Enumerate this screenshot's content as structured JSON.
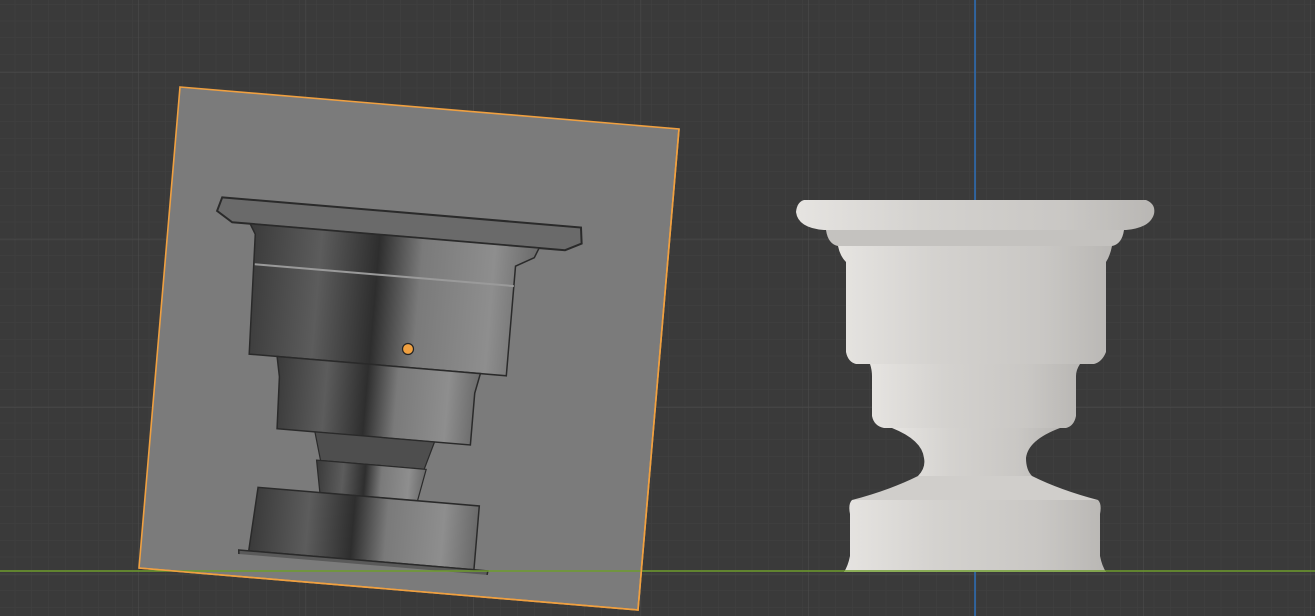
{
  "viewport": {
    "view": "front-orthographic",
    "background_color": "#3a3a3a",
    "grid_minor_color": "#404040",
    "grid_major_color": "#4a4a4a",
    "axis_x_color": "#6e9c2c",
    "axis_z_color": "#2c6ab0"
  },
  "objects": [
    {
      "id": "reference-image",
      "type": "image-empty",
      "selected": true,
      "selection_color": "#f0a040",
      "origin_color": "#f0a040"
    },
    {
      "id": "goblet-mesh",
      "type": "mesh",
      "selected": false,
      "material_color": "#d2d0cd"
    }
  ]
}
